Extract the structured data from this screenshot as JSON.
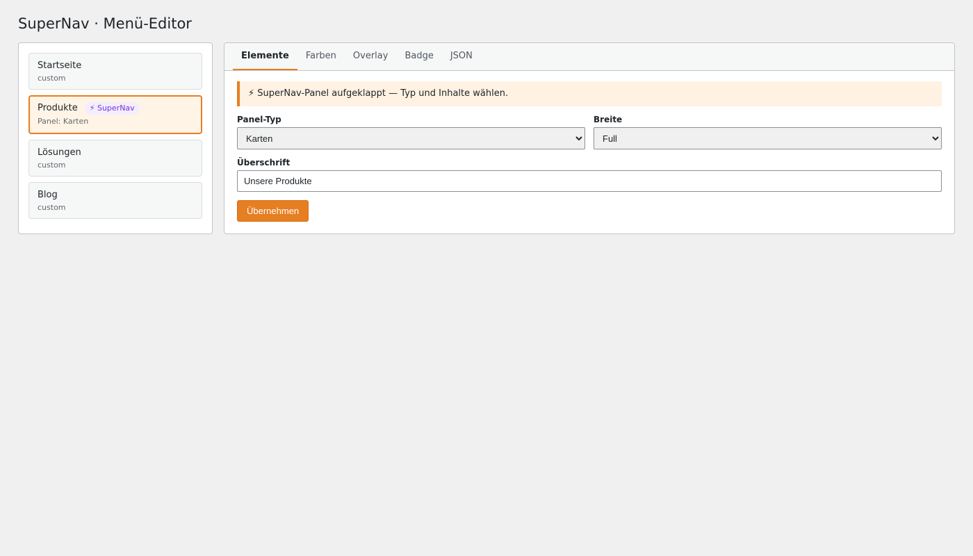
{
  "page": {
    "title": "SuperNav · Menü-Editor"
  },
  "sidebar": {
    "items": [
      {
        "label": "Startseite",
        "sub": "custom",
        "active": false
      },
      {
        "label": "Produkte",
        "sub": "Panel: Karten",
        "badge": "⚡ SuperNav",
        "active": true
      },
      {
        "label": "Lösungen",
        "sub": "custom",
        "active": false
      },
      {
        "label": "Blog",
        "sub": "custom",
        "active": false
      }
    ]
  },
  "tabs": [
    {
      "label": "Elemente",
      "active": true
    },
    {
      "label": "Farben"
    },
    {
      "label": "Overlay"
    },
    {
      "label": "Badge"
    },
    {
      "label": "JSON"
    }
  ],
  "notice": "⚡ SuperNav-Panel aufgeklappt — Typ und Inhalte wählen.",
  "form": {
    "panel_type_label": "Panel-Typ",
    "panel_type_value": "Karten",
    "width_label": "Breite",
    "width_value": "Full",
    "heading_label": "Überschrift",
    "heading_value": "Unsere Produkte",
    "apply_label": "Übernehmen"
  },
  "colors": {
    "accent": "#e67e22",
    "badge": "#7b2fd6"
  }
}
